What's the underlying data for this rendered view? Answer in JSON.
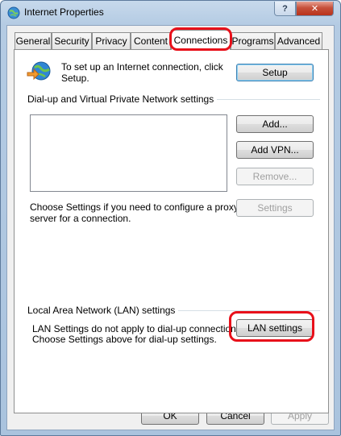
{
  "window": {
    "title": "Internet Properties",
    "help_label": "?",
    "close_label": "✕"
  },
  "tabs": [
    {
      "label": "General"
    },
    {
      "label": "Security"
    },
    {
      "label": "Privacy"
    },
    {
      "label": "Content"
    },
    {
      "label": "Connections"
    },
    {
      "label": "Programs"
    },
    {
      "label": "Advanced"
    }
  ],
  "connections": {
    "setup_text_1": "To set up an Internet connection, click",
    "setup_text_2": "Setup.",
    "setup_button": "Setup",
    "dialup_group": "Dial-up and Virtual Private Network settings",
    "add_button": "Add...",
    "add_vpn_button": "Add VPN...",
    "remove_button": "Remove...",
    "proxy_text_1": "Choose Settings if you need to configure a proxy",
    "proxy_text_2": "server for a connection.",
    "settings_button": "Settings",
    "lan_group": "Local Area Network (LAN) settings",
    "lan_text_1": "LAN Settings do not apply to dial-up connections.",
    "lan_text_2": "Choose Settings above for dial-up settings.",
    "lan_button": "LAN settings"
  },
  "footer": {
    "ok": "OK",
    "cancel": "Cancel",
    "apply": "Apply"
  },
  "colors": {
    "highlight": "#e8101a",
    "title_bar": "#b4cbe3"
  }
}
